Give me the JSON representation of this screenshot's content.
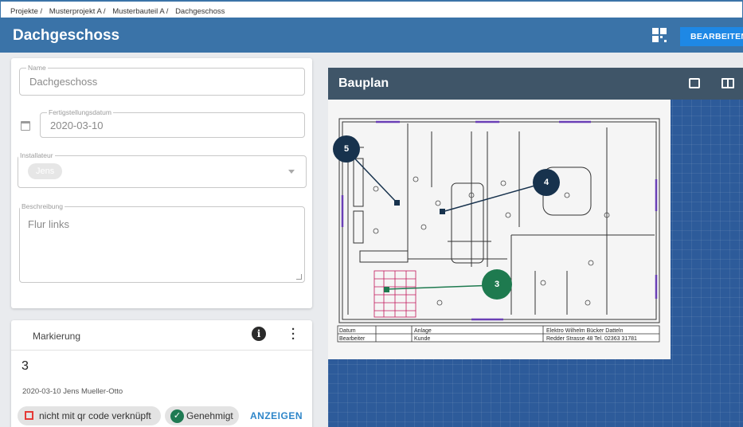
{
  "breadcrumb": [
    "Projekte /",
    "Musterprojekt A /",
    "Musterbauteil A /",
    "Dachgeschoss"
  ],
  "header": {
    "title": "Dachgeschoss",
    "edit_label": "BEARBEITEN",
    "qr_icon": "qr-code-icon"
  },
  "form": {
    "name_label": "Name",
    "name_value": "Dachgeschoss",
    "date_label": "Fertigstellungsdatum",
    "date_value": "2020-03-10",
    "installer_label": "Installateur",
    "installer_chip": "Jens",
    "description_label": "Beschreibung",
    "description_value": "Flur links"
  },
  "marker_card": {
    "title": "Markierung",
    "number": "3",
    "meta": "2020-03-10 Jens Mueller-Otto",
    "qr_chip": "nicht mit qr code verknüpft",
    "approved_chip": "Genehmigt",
    "show_label": "ANZEIGEN"
  },
  "plan": {
    "title": "Bauplan",
    "markers": [
      {
        "number": "5",
        "color": "#17324d"
      },
      {
        "number": "4",
        "color": "#17324d"
      },
      {
        "number": "3",
        "color": "#1e7a4f"
      }
    ],
    "titleblock": {
      "datum": "Datum",
      "bearbeiter": "Bearbeiter",
      "anlage": "Anlage",
      "kunde": "Kunde",
      "firma": "Elektro Wilhelm Bücker Datteln",
      "adresse": "Redder Strasse 48 Tel. 02363 31781"
    }
  },
  "colors": {
    "primary": "#3a73a8",
    "accent": "#1e88e5",
    "plan_bg": "#2d5b9a",
    "plan_header": "#3f5568"
  }
}
